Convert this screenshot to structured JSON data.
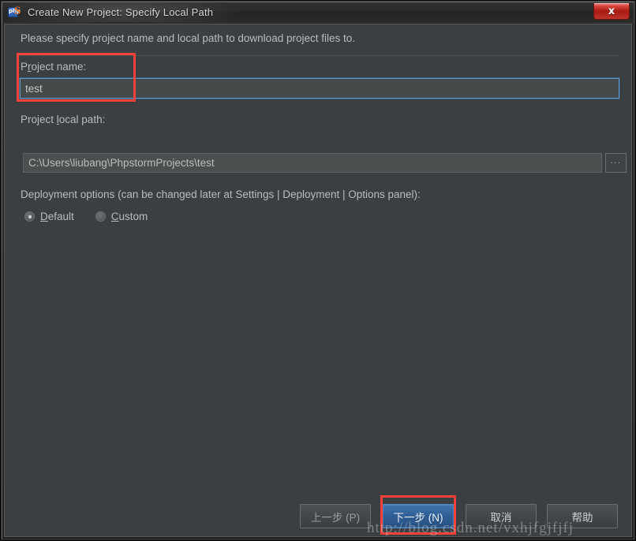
{
  "window": {
    "title": "Create New Project: Specify Local Path",
    "app_icon": "phpstorm-icon",
    "php_badge": "php",
    "s_badge": "S",
    "close_label": "x"
  },
  "content": {
    "intro": "Please specify project name and local path to download project files to.",
    "project_name": {
      "label_before": "P",
      "label_mnemonic": "r",
      "label_after": "oject name:",
      "value": "test",
      "placeholder": "Project name"
    },
    "project_path": {
      "label_before": "Project ",
      "label_mnemonic": "l",
      "label_after": "ocal path:",
      "value": "C:\\Users\\liubang\\PhpstormProjects\\test",
      "placeholder": "Project local path",
      "browse_label": "..."
    },
    "deployment": {
      "description": "Deployment options (can be changed later at Settings | Deployment | Options panel):",
      "options": [
        {
          "mnemonic": "D",
          "rest": "efault",
          "selected": true
        },
        {
          "mnemonic": "C",
          "rest": "ustom",
          "selected": false
        }
      ]
    }
  },
  "buttons": {
    "back": "上一步 (P)",
    "next": "下一步 (N)",
    "cancel": "取消",
    "help": "帮助"
  },
  "watermark": "http://blog.csdn.net/vxhjfgjfjfj",
  "colors": {
    "panel_bg": "#3c3f41",
    "text": "#bbbbbb",
    "focus_border": "#5b9ad4",
    "primary_button": "#2f5e95",
    "annotation": "#f6403a",
    "close_button": "#a81a12"
  }
}
